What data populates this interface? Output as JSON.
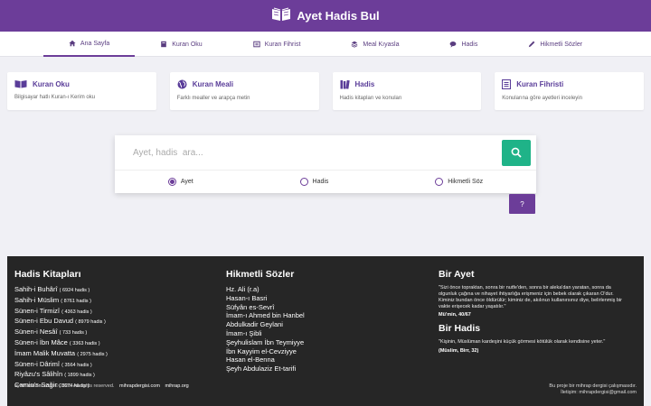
{
  "header": {
    "title": "Ayet Hadis Bul",
    "brand_color": "#6c3d99",
    "logo_icon": "open-book-icon"
  },
  "nav": [
    {
      "label": "Ana Sayfa",
      "icon": "home-icon",
      "active": true
    },
    {
      "label": "Kuran Oku",
      "icon": "book-icon"
    },
    {
      "label": "Kuran Fihrist",
      "icon": "list-icon"
    },
    {
      "label": "Meal Kıyasla",
      "icon": "layers-icon"
    },
    {
      "label": "Hadis",
      "icon": "comment-icon"
    },
    {
      "label": "Hikmetli Sözler",
      "icon": "pen-icon"
    }
  ],
  "cards": [
    {
      "title": "Kuran Oku",
      "desc": "Bilgisayar hatlı Kuran-ı Kerim oku",
      "icon": "book-open-icon"
    },
    {
      "title": "Kuran Meali",
      "desc": "Farklı mealler ve arapça metin",
      "icon": "globe-icon"
    },
    {
      "title": "Hadis",
      "desc": "Hadis kitapları ve konuları",
      "icon": "books-icon"
    },
    {
      "title": "Kuran Fihristi",
      "desc": "Konularına göre ayetleri inceleyin",
      "icon": "index-icon"
    }
  ],
  "search": {
    "placeholder": "Ayet, hadis  ara...",
    "button_color": "#1fb388",
    "options": [
      {
        "label": "Ayet",
        "selected": true
      },
      {
        "label": "Hadis",
        "selected": false
      },
      {
        "label": "Hikmetli Söz",
        "selected": false
      }
    ],
    "help_label": "?"
  },
  "footer": {
    "hadis_kitaplari": {
      "heading": "Hadis Kitapları",
      "items": [
        {
          "name": "Sahih-i Buhârî",
          "count": "( 6924 hadis )"
        },
        {
          "name": "Sahih-i Müslim",
          "count": "( 8761 hadis )"
        },
        {
          "name": "Sünen-i Tirmizî",
          "count": "( 4363 hadis )"
        },
        {
          "name": "Sünen-i Ebu Davud",
          "count": "( 8979 hadis )"
        },
        {
          "name": "Sünen-i Nesâî",
          "count": "( 733 hadis )"
        },
        {
          "name": "Sünen-i İbn Mâce",
          "count": "( 3363 hadis )"
        },
        {
          "name": "İmam Malik Muvatta",
          "count": "( 2975 hadis )"
        },
        {
          "name": "Sünen-i Dârimî",
          "count": "( 3564 hadis )"
        },
        {
          "name": "Riyâzu's Sâlihîn",
          "count": "( 1899 hadis )"
        },
        {
          "name": "Camiu's-Sağir",
          "count": "( 3674 hadis )"
        }
      ]
    },
    "hikmetli_sozler": {
      "heading": "Hikmetli Sözler",
      "items": [
        "Hz. Ali (r.a)",
        "Hasan-ı Basri",
        "Süfyân es-Sevrî",
        "İmam-ı Ahmed bin Hanbel",
        "Abdulkadir Geylani",
        "İmam-ı Şibli",
        "Şeyhulislam İbn Teymiyye",
        "İbn Kayyim el-Cevziyye",
        "Hasan el-Benna",
        "Şeyh Abdulaziz Et-tarifi"
      ]
    },
    "bir_ayet": {
      "heading": "Bir Ayet",
      "text": "\"Sizi önce topraktan, sonra bir nutfe'den, sonra bir aleka'dan yaratan, sonra da olgunluk çağına ve nihayet ihtiyarlığa erişmeniz için bebek olarak çıkaran O'dur. Kiminiz bundan önce öldürülür; kiminiz de, akılınızı kullanırsınız diye, belirlenmiş bir vakte erişecek kadar yaşatılır.\"",
      "ref": "Mü'min, 40/67"
    },
    "bir_hadis": {
      "heading": "Bir Hadis",
      "text": "\"Kişinin, Müslüman kardeşini küçük görmesi kötülük olarak kendisine yeter.\"",
      "ref": "(Müslim, Birr, 32)"
    },
    "copyright": "ayethadisbul.com © 2020. All rights reserved.",
    "links": [
      "mihrapdergisi.com",
      "mihrap.org"
    ],
    "about_line1": "Bu proje bir mihrap dergisi çalışmasıdır.",
    "about_line2": "İletişim: mihrapdergisi@gmail.com"
  }
}
